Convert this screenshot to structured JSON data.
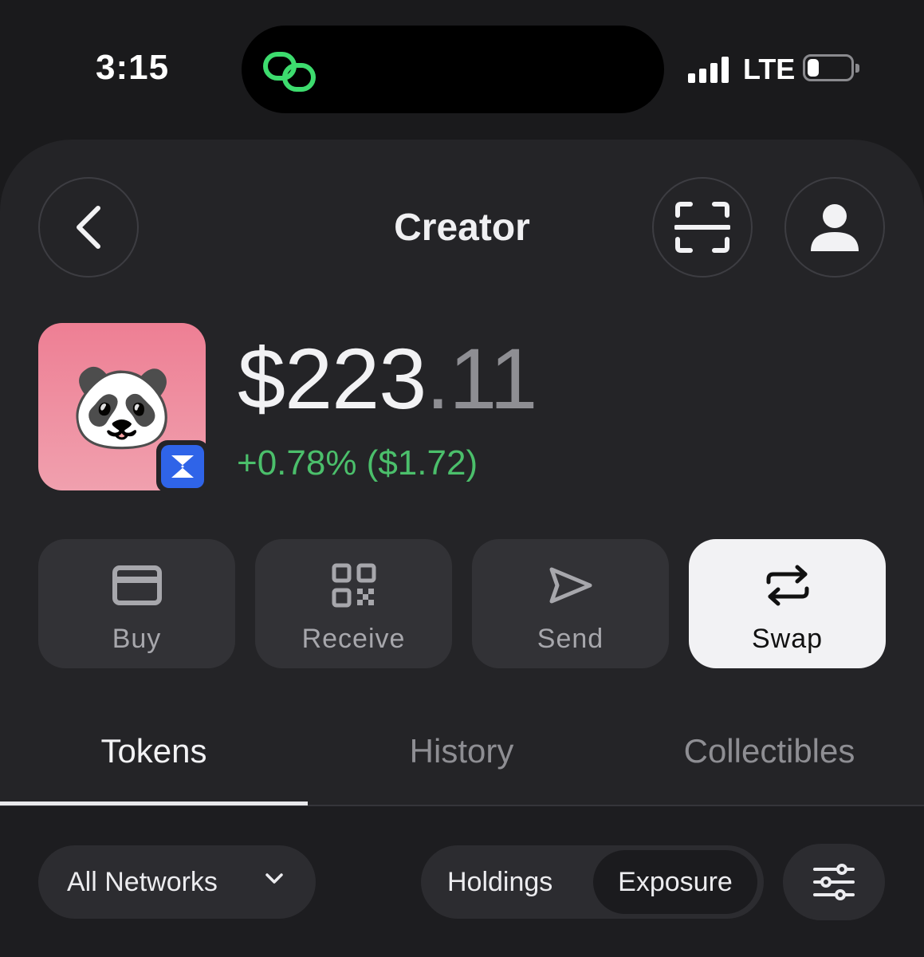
{
  "status_bar": {
    "time": "3:15",
    "network": "LTE",
    "island_icon": "link-rings-icon",
    "island_color": "#3ddc6e"
  },
  "header": {
    "title": "Creator",
    "back_icon": "chevron-left-icon",
    "scan_icon": "scan-frame-icon",
    "profile_icon": "person-icon"
  },
  "account": {
    "avatar_emoji": "🐼",
    "avatar_color": "#ee8a9c",
    "network_badge_color": "#2f64e8",
    "balance_whole": "$223",
    "balance_decimal": ".11",
    "change": "+0.78% ($1.72)",
    "change_color": "#4bbf6b"
  },
  "actions": [
    {
      "label": "Buy",
      "icon": "credit-card-icon"
    },
    {
      "label": "Receive",
      "icon": "qr-code-icon"
    },
    {
      "label": "Send",
      "icon": "paper-plane-icon"
    },
    {
      "label": "Swap",
      "icon": "swap-arrows-icon"
    }
  ],
  "tabs": [
    {
      "label": "Tokens",
      "active": true
    },
    {
      "label": "History",
      "active": false
    },
    {
      "label": "Collectibles",
      "active": false
    }
  ],
  "filters": {
    "network_select": "All Networks",
    "segment": [
      "Holdings",
      "Exposure"
    ],
    "segment_selected": "Exposure",
    "filter_icon": "sliders-icon"
  }
}
